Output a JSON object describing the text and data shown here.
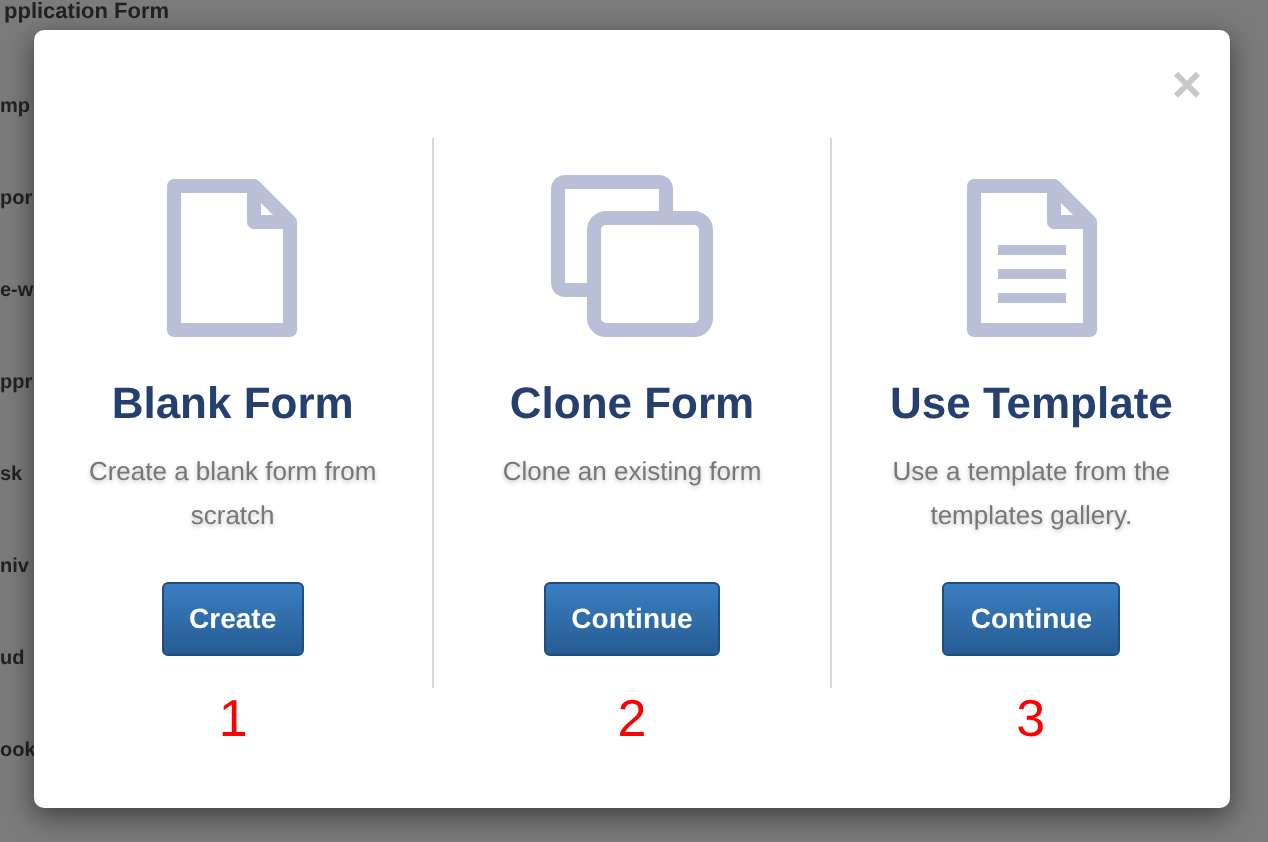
{
  "background": {
    "heading": "pplication Form",
    "items": [
      "mp",
      "por",
      "e-w",
      "ppr",
      "sk",
      "niv",
      "ud",
      "ook"
    ]
  },
  "dialog": {
    "close": "×",
    "options": [
      {
        "kind": "blank",
        "title": "Blank Form",
        "description": "Create a blank form from scratch",
        "button": "Create",
        "number": "1"
      },
      {
        "kind": "clone",
        "title": "Clone Form",
        "description": "Clone an existing form",
        "button": "Continue",
        "number": "2"
      },
      {
        "kind": "template",
        "title": "Use Template",
        "description": "Use a template from the templates gallery.",
        "button": "Continue",
        "number": "3"
      }
    ]
  }
}
